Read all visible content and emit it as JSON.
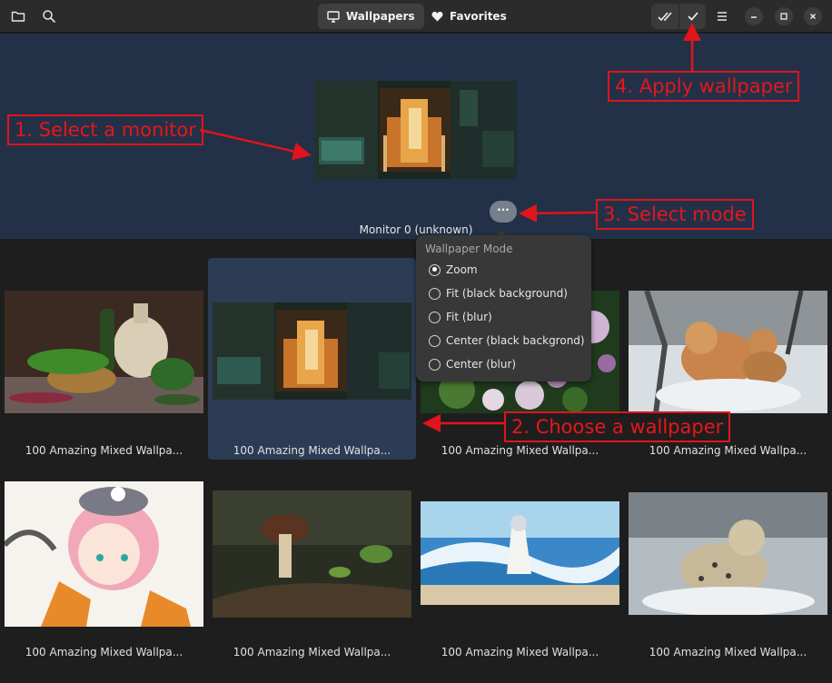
{
  "header": {
    "tabs": [
      {
        "label": "Wallpapers",
        "icon": "monitor-icon",
        "active": true
      },
      {
        "label": "Favorites",
        "icon": "heart-icon",
        "active": false
      }
    ],
    "icons": [
      "folder-icon",
      "search-icon",
      "apply-all-icon",
      "apply-icon",
      "menu-icon",
      "minimize-icon",
      "maximize-icon",
      "close-icon"
    ]
  },
  "monitor": {
    "label": "Monitor 0 (unknown)",
    "mode_button": "···"
  },
  "mode_popover": {
    "title": "Wallpaper Mode",
    "options": [
      {
        "label": "Zoom",
        "selected": true
      },
      {
        "label": "Fit (black background)",
        "selected": false
      },
      {
        "label": "Fit (blur)",
        "selected": false
      },
      {
        "label": "Center (black backgrond)",
        "selected": false
      },
      {
        "label": "Center (blur)",
        "selected": false
      }
    ]
  },
  "wallpapers": [
    {
      "label": "100 Amazing Mixed Wallpa...",
      "scene": "still-life",
      "selected": false
    },
    {
      "label": "100 Amazing Mixed Wallpa...",
      "scene": "anime-tram",
      "selected": true
    },
    {
      "label": "100 Amazing Mixed Wallpa...",
      "scene": "flowers",
      "selected": false
    },
    {
      "label": "100 Amazing Mixed Wallpa...",
      "scene": "lynx",
      "selected": false
    },
    {
      "label": "100 Amazing Mixed Wallpa...",
      "scene": "anime-girl",
      "selected": false
    },
    {
      "label": "100 Amazing Mixed Wallpa...",
      "scene": "mushroom",
      "selected": false
    },
    {
      "label": "100 Amazing Mixed Wallpa...",
      "scene": "beach",
      "selected": false
    },
    {
      "label": "100 Amazing Mixed Wallpa...",
      "scene": "snow-leopard",
      "selected": false
    }
  ],
  "annotations": {
    "select_monitor": "1. Select a monitor",
    "choose_wallpaper": "2. Choose a wallpaper",
    "select_mode": "3. Select mode",
    "apply_wallpaper": "4. Apply wallpaper"
  },
  "colors": {
    "accent_panel": "#223148",
    "selected_cell": "#2c3c54",
    "annotation_red": "#e0141b"
  }
}
